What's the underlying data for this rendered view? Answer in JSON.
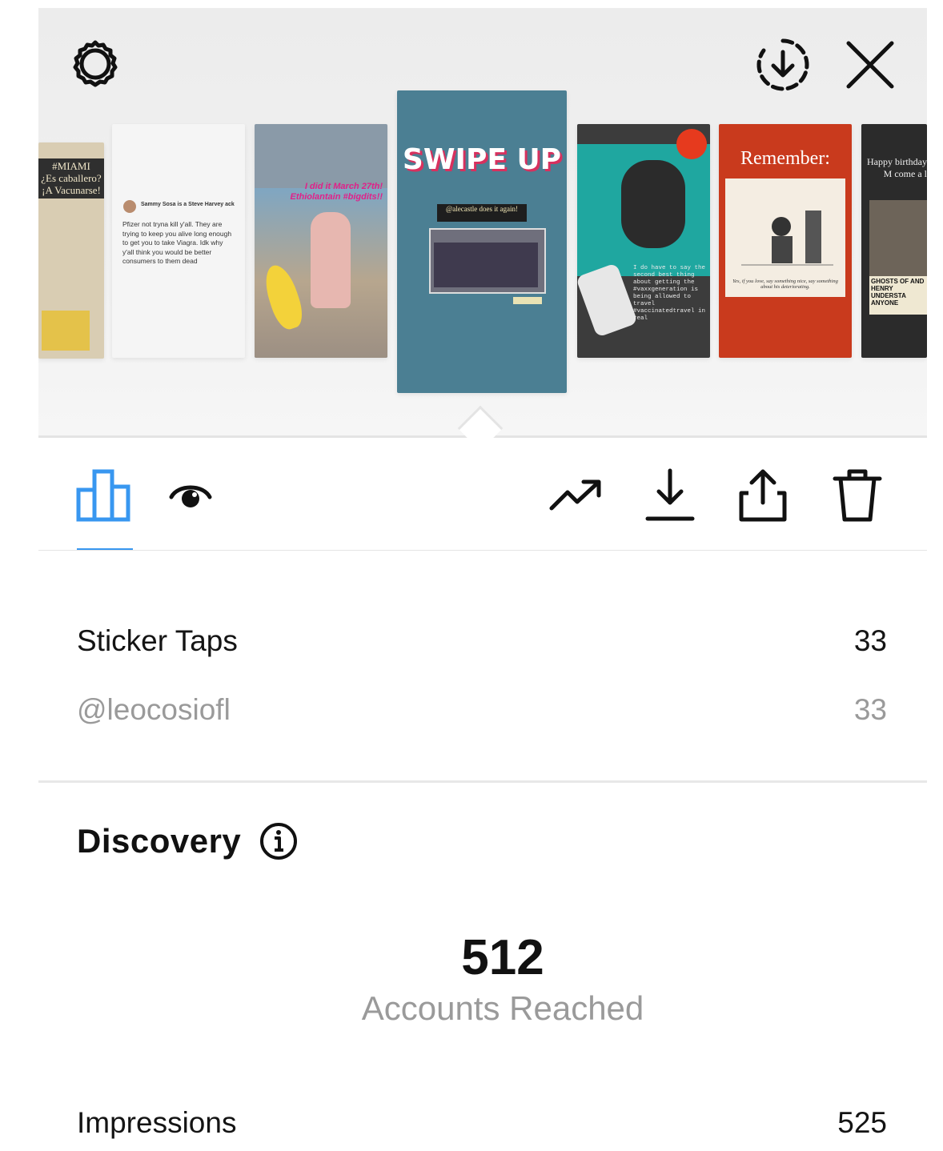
{
  "header": {
    "settings_icon": "settings-icon",
    "save_icon": "download-circle-icon",
    "close_icon": "close-icon"
  },
  "stories": [
    {
      "label": "#MIAMI\n¿Es caballero?\n¡A Vacunarse!"
    },
    {
      "author": "Sammy Sosa is a Steve Harvey ack",
      "text": "Pfizer not tryna kill y'all. They are trying to keep you alive long enough to get you to take Viagra. Idk why y'all think you would be better consumers to them dead"
    },
    {
      "headline": "I did it March 27th! Ethiolantain #bigdits!!"
    },
    {
      "headline": "SWIPE UP",
      "caption": "@alecastle does it again!"
    },
    {
      "note": "I do have to say the second best thing about getting the #vaxxgeneration is being allowed to travel #vaccinatedtravel in real"
    },
    {
      "title": "Remember:",
      "caption": "Yes, if you love, say something nice, say something about his deteriorating."
    },
    {
      "text": "Happy birthday M come a l",
      "poster": "GHOSTS OF AND HENRY UNDERSTA ANYONE"
    }
  ],
  "toolbar": {
    "accent": "#3897f0",
    "tabs": [
      "insights",
      "viewers"
    ],
    "actions": [
      "promote",
      "download",
      "share",
      "delete"
    ]
  },
  "interactions": {
    "sticker_taps_label": "Sticker Taps",
    "sticker_taps_value": "33",
    "handle": "@leocosiofl",
    "handle_value": "33"
  },
  "discovery": {
    "title": "Discovery",
    "accounts_reached_value": "512",
    "accounts_reached_label": "Accounts Reached",
    "impressions_label": "Impressions",
    "impressions_value": "525"
  }
}
